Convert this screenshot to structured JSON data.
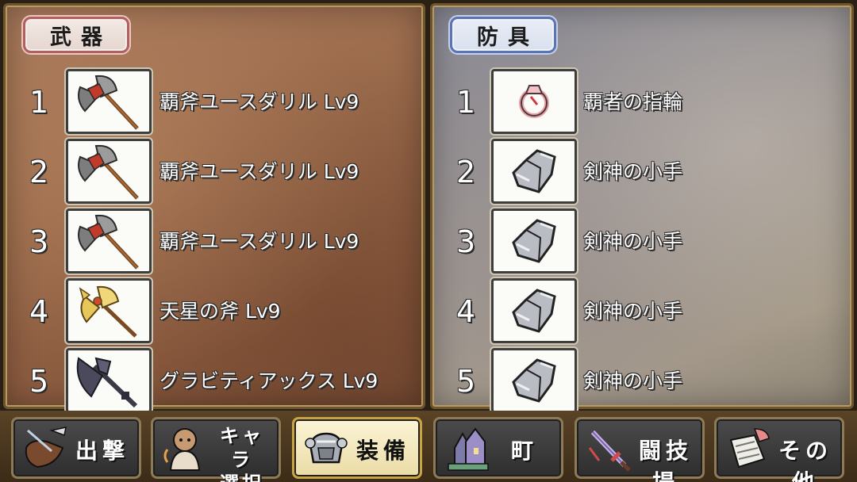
{
  "weapons": {
    "title": "武器",
    "items": [
      {
        "rank": "1",
        "name": "覇斧ユースダリル Lv9",
        "icon": "battle-axe-icon"
      },
      {
        "rank": "2",
        "name": "覇斧ユースダリル Lv9",
        "icon": "battle-axe-icon"
      },
      {
        "rank": "3",
        "name": "覇斧ユースダリル Lv9",
        "icon": "battle-axe-icon"
      },
      {
        "rank": "4",
        "name": "天星の斧 Lv9",
        "icon": "golden-axe-icon"
      },
      {
        "rank": "5",
        "name": "グラビティアックス Lv9",
        "icon": "dark-axe-icon"
      }
    ]
  },
  "armor": {
    "title": "防具",
    "items": [
      {
        "rank": "1",
        "name": "覇者の指輪",
        "icon": "ring-icon"
      },
      {
        "rank": "2",
        "name": "剣神の小手",
        "icon": "gauntlet-icon"
      },
      {
        "rank": "3",
        "name": "剣神の小手",
        "icon": "gauntlet-icon"
      },
      {
        "rank": "4",
        "name": "剣神の小手",
        "icon": "gauntlet-icon"
      },
      {
        "rank": "5",
        "name": "剣神の小手",
        "icon": "gauntlet-icon"
      }
    ]
  },
  "nav": {
    "sortie": "出撃",
    "chara_line1": "キャラ",
    "chara_line2": "選択",
    "equip": "装備",
    "town": "町",
    "arena": "闘技場",
    "other": "その他",
    "active": "equip"
  },
  "colors": {
    "weapons_accent": "#b06060",
    "armor_accent": "#5b74b3",
    "active_nav": "#ebdca6"
  }
}
